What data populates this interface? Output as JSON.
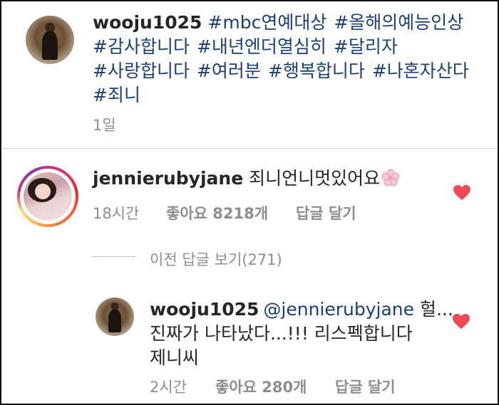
{
  "post": {
    "username": "wooju1025",
    "hashtags": [
      "#mbc연예대상",
      "#올해의예능인상",
      "#감사합니다",
      "#내년엔더열심히",
      "#달리자",
      "#사랑합니다",
      "#여러분",
      "#행복합니다",
      "#나혼자산다",
      "#죄니"
    ],
    "time": "1일"
  },
  "comment": {
    "username": "jennierubyjane",
    "text": "죄니언니멋있어요",
    "emoji": "cherry-blossom",
    "time": "18시간",
    "likes_label": "좋아요 8218개",
    "reply_label": "답글 달기",
    "liked": true
  },
  "view_replies": {
    "label": "이전 답글 보기(271)"
  },
  "reply": {
    "username": "wooju1025",
    "mention": "@jennierubyjane",
    "text_line1_tail": " 헐...",
    "text_line2": "진짜가 나타났다...!!! 리스펙합니다",
    "text_line3": "제니씨",
    "time": "2시간",
    "likes_label": "좋아요 280개",
    "reply_label": "답글 달기",
    "liked": true
  },
  "colors": {
    "heart": "#ed4956",
    "hashtag": "#1b3f7a",
    "muted": "#8e8e8e"
  }
}
